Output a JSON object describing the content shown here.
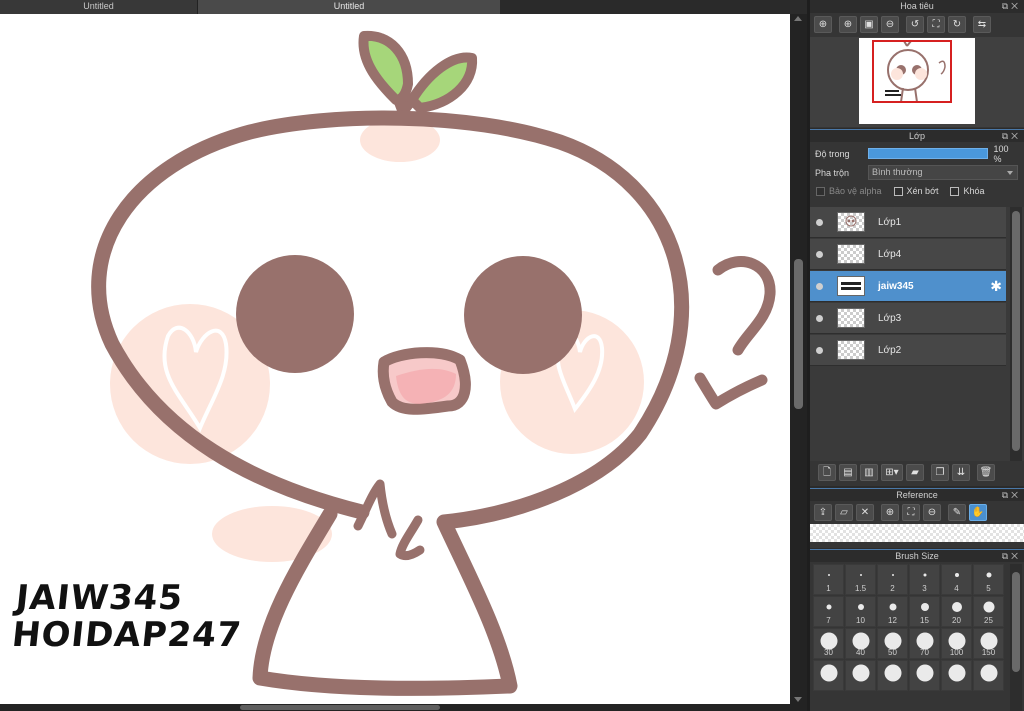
{
  "tabs": [
    "Untitled",
    "Untitled"
  ],
  "canvas": {
    "signature_lines": [
      "JAIW345",
      "HOIDAP247"
    ]
  },
  "navigator": {
    "title": "Hoa tiêu",
    "tools": [
      "zoom-fit-icon",
      "zoom-in-icon",
      "actual-size-icon",
      "zoom-out-icon",
      "rotate-left-icon",
      "fit-window-icon",
      "rotate-right-icon",
      "flip-icon"
    ]
  },
  "layers": {
    "title": "Lớp",
    "opacity_label": "Độ trong",
    "opacity_value": "100 %",
    "opacity_fraction": 1.0,
    "blend_label": "Pha trộn",
    "blend_value": "Bình thường",
    "protect_alpha": "Bảo vệ alpha",
    "clipping": "Xén bớt",
    "lock": "Khóa",
    "items": [
      {
        "name": "Lớp1",
        "selected": false
      },
      {
        "name": "Lớp4",
        "selected": false
      },
      {
        "name": "jaiw345",
        "selected": true
      },
      {
        "name": "Lớp3",
        "selected": false
      },
      {
        "name": "Lớp2",
        "selected": false
      }
    ]
  },
  "reference": {
    "title": "Reference"
  },
  "brush": {
    "title": "Brush Size",
    "sizes": [
      "1",
      "1.5",
      "2",
      "3",
      "4",
      "5",
      "7",
      "10",
      "12",
      "15",
      "20",
      "25",
      "30",
      "40",
      "50",
      "70",
      "100",
      "150",
      "",
      "",
      "",
      "",
      "",
      ""
    ]
  },
  "colors": {
    "accent": "#4f90cc",
    "stroke": "#98716c",
    "blush": "#fde5dc"
  }
}
